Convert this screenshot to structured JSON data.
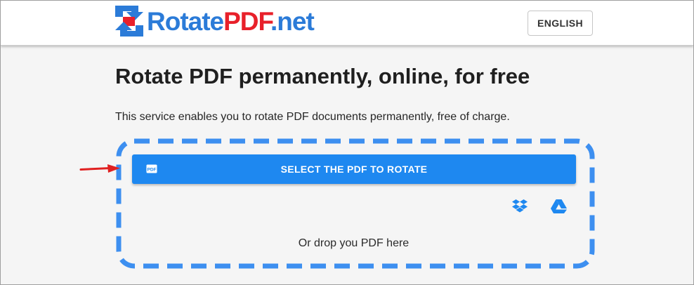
{
  "header": {
    "logo_prefix": "Rotate",
    "logo_pdf": "PDF",
    "logo_suffix": ".net",
    "language_button": "ENGLISH"
  },
  "main": {
    "title": "Rotate PDF permanently, online, for free",
    "description": "This service enables you to rotate PDF documents permanently, free of charge.",
    "select_button": "SELECT THE PDF TO ROTATE",
    "drop_text": "Or drop you PDF here",
    "file_icon_text": "PDF"
  },
  "icons": {
    "logo": "rotate-arrows-logo-icon",
    "file": "pdf-file-icon",
    "pointer": "red-arrow-icon",
    "dropbox": "dropbox-icon",
    "google_drive": "google-drive-icon"
  },
  "colors": {
    "brand_blue": "#2b7bd8",
    "brand_red": "#e8202a",
    "button_blue": "#1e88f0",
    "dash_blue": "#3d8ff0",
    "arrow_red": "#e02020"
  }
}
